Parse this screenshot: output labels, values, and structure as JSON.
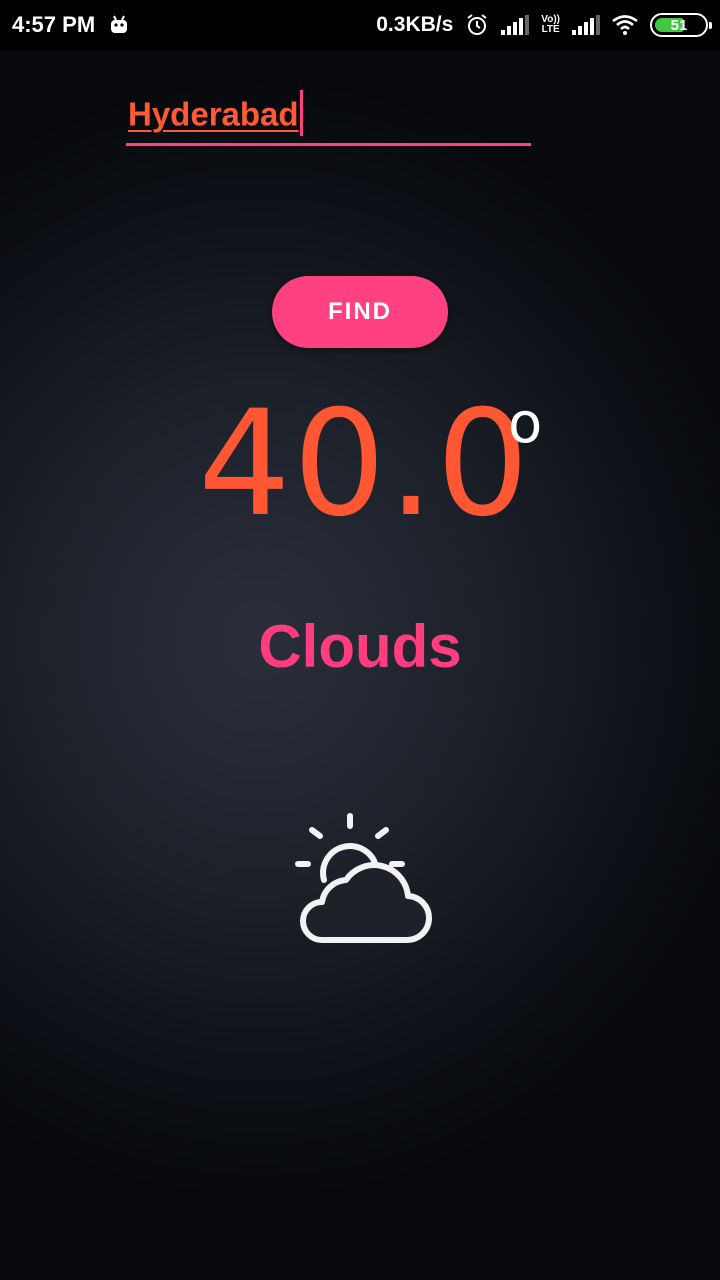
{
  "status_bar": {
    "time": "4:57 PM",
    "net_speed": "0.3KB/s",
    "volte_top": "Vo))",
    "volte_bottom": "LTE",
    "battery": "51"
  },
  "search": {
    "city_value": "Hyderabad"
  },
  "find_button": {
    "label": "FIND"
  },
  "weather": {
    "temperature": "40.0",
    "degree_symbol": "o",
    "condition": "Clouds",
    "icon": "partly-cloudy-icon"
  },
  "colors": {
    "accent": "#ff4081",
    "temperature": "#ff5733",
    "city_text": "#ff5a36"
  }
}
